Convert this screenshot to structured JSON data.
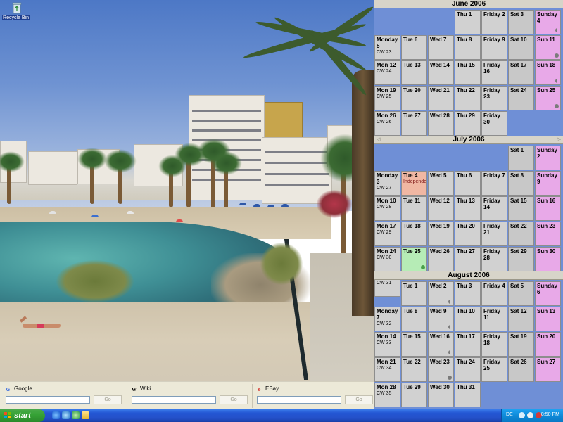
{
  "desktop": {
    "icon_label": "Recycle Bin"
  },
  "calendar": {
    "months": [
      {
        "title": "June 2006",
        "weeks": [
          {
            "label": "",
            "cw": "",
            "days": [
              {
                "text": "",
                "type": "empty"
              },
              {
                "text": "",
                "type": "empty"
              },
              {
                "text": "",
                "type": "empty"
              },
              {
                "text": "Thu 1",
                "type": "weekday"
              },
              {
                "text": "Friday 2",
                "type": "weekday"
              },
              {
                "text": "Sat 3",
                "type": "sat"
              },
              {
                "text": "Sunday 4",
                "type": "sun",
                "marker": "half"
              }
            ]
          },
          {
            "label": "Monday 5",
            "cw": "CW 23",
            "days": [
              {
                "text": "Tue 6",
                "type": "weekday"
              },
              {
                "text": "Wed 7",
                "type": "weekday"
              },
              {
                "text": "Thu 8",
                "type": "weekday"
              },
              {
                "text": "Friday 9",
                "type": "weekday"
              },
              {
                "text": "Sat 10",
                "type": "sat"
              },
              {
                "text": "Sun 11",
                "type": "sun",
                "marker": "dot"
              }
            ]
          },
          {
            "label": "Mon 12",
            "cw": "CW 24",
            "days": [
              {
                "text": "Tue 13",
                "type": "weekday"
              },
              {
                "text": "Wed 14",
                "type": "weekday"
              },
              {
                "text": "Thu 15",
                "type": "weekday"
              },
              {
                "text": "Friday 16",
                "type": "weekday"
              },
              {
                "text": "Sat 17",
                "type": "sat"
              },
              {
                "text": "Sun 18",
                "type": "sun",
                "marker": "half"
              }
            ]
          },
          {
            "label": "Mon 19",
            "cw": "CW 25",
            "days": [
              {
                "text": "Tue 20",
                "type": "weekday"
              },
              {
                "text": "Wed 21",
                "type": "weekday"
              },
              {
                "text": "Thu 22",
                "type": "weekday"
              },
              {
                "text": "Friday 23",
                "type": "weekday"
              },
              {
                "text": "Sat 24",
                "type": "sat"
              },
              {
                "text": "Sun 25",
                "type": "sun",
                "marker": "dot"
              }
            ]
          },
          {
            "label": "Mon 26",
            "cw": "CW 26",
            "days": [
              {
                "text": "Tue 27",
                "type": "weekday"
              },
              {
                "text": "Wed 28",
                "type": "weekday"
              },
              {
                "text": "Thu 29",
                "type": "weekday"
              },
              {
                "text": "Friday 30",
                "type": "weekday"
              },
              {
                "text": "",
                "type": "empty"
              },
              {
                "text": "",
                "type": "empty"
              }
            ]
          }
        ]
      },
      {
        "title": "July 2006",
        "nav_prev": "◁",
        "nav_next": "▷",
        "weeks": [
          {
            "label": "",
            "cw": "",
            "days": [
              {
                "text": "",
                "type": "empty"
              },
              {
                "text": "",
                "type": "empty"
              },
              {
                "text": "",
                "type": "empty"
              },
              {
                "text": "",
                "type": "empty"
              },
              {
                "text": "",
                "type": "empty"
              },
              {
                "text": "Sat 1",
                "type": "sat"
              },
              {
                "text": "Sunday 2",
                "type": "sun"
              }
            ]
          },
          {
            "label": "Monday 3",
            "cw": "CW 27",
            "days": [
              {
                "text": "Tue 4",
                "type": "holiday",
                "event": "Independence"
              },
              {
                "text": "Wed 5",
                "type": "weekday"
              },
              {
                "text": "Thu 6",
                "type": "weekday"
              },
              {
                "text": "Friday 7",
                "type": "weekday"
              },
              {
                "text": "Sat 8",
                "type": "sat"
              },
              {
                "text": "Sunday 9",
                "type": "sun"
              }
            ]
          },
          {
            "label": "Mon 10",
            "cw": "CW 28",
            "days": [
              {
                "text": "Tue 11",
                "type": "weekday"
              },
              {
                "text": "Wed 12",
                "type": "weekday"
              },
              {
                "text": "Thu 13",
                "type": "weekday"
              },
              {
                "text": "Friday 14",
                "type": "weekday"
              },
              {
                "text": "Sat 15",
                "type": "sat"
              },
              {
                "text": "Sun 16",
                "type": "sun"
              }
            ]
          },
          {
            "label": "Mon 17",
            "cw": "CW 29",
            "days": [
              {
                "text": "Tue 18",
                "type": "weekday"
              },
              {
                "text": "Wed 19",
                "type": "weekday"
              },
              {
                "text": "Thu 20",
                "type": "weekday"
              },
              {
                "text": "Friday 21",
                "type": "weekday"
              },
              {
                "text": "Sat 22",
                "type": "sat"
              },
              {
                "text": "Sun 23",
                "type": "sun"
              }
            ]
          },
          {
            "label": "Mon 24",
            "cw": "CW 30",
            "days": [
              {
                "text": "Tue 25",
                "type": "today",
                "marker": "green"
              },
              {
                "text": "Wed 26",
                "type": "weekday"
              },
              {
                "text": "Thu 27",
                "type": "weekday"
              },
              {
                "text": "Friday 28",
                "type": "weekday"
              },
              {
                "text": "Sat 29",
                "type": "sat"
              },
              {
                "text": "Sun 30",
                "type": "sun"
              }
            ]
          },
          {
            "label": "Mon 31",
            "cw": "CW 31",
            "days": [
              {
                "text": "",
                "type": "empty"
              },
              {
                "text": "",
                "type": "empty"
              },
              {
                "text": "",
                "type": "empty"
              },
              {
                "text": "",
                "type": "empty"
              },
              {
                "text": "",
                "type": "empty"
              },
              {
                "text": "",
                "type": "empty"
              }
            ]
          }
        ]
      },
      {
        "title": "August 2006",
        "weeks": [
          {
            "label": "",
            "cw": "",
            "days": [
              {
                "text": "Tue 1",
                "type": "weekday"
              },
              {
                "text": "Wed 2",
                "type": "weekday",
                "marker": "half"
              },
              {
                "text": "Thu 3",
                "type": "weekday"
              },
              {
                "text": "Friday 4",
                "type": "weekday"
              },
              {
                "text": "Sat 5",
                "type": "sat"
              },
              {
                "text": "Sunday 6",
                "type": "sun"
              }
            ]
          },
          {
            "label": "Monday 7",
            "cw": "CW 32",
            "days": [
              {
                "text": "Tue 8",
                "type": "weekday"
              },
              {
                "text": "Wed 9",
                "type": "weekday",
                "marker": "half"
              },
              {
                "text": "Thu 10",
                "type": "weekday"
              },
              {
                "text": "Friday 11",
                "type": "weekday"
              },
              {
                "text": "Sat 12",
                "type": "sat"
              },
              {
                "text": "Sun 13",
                "type": "sun"
              }
            ]
          },
          {
            "label": "Mon 14",
            "cw": "CW 33",
            "days": [
              {
                "text": "Tue 15",
                "type": "weekday"
              },
              {
                "text": "Wed 16",
                "type": "weekday",
                "marker": "half"
              },
              {
                "text": "Thu 17",
                "type": "weekday"
              },
              {
                "text": "Friday 18",
                "type": "weekday"
              },
              {
                "text": "Sat 19",
                "type": "sat"
              },
              {
                "text": "Sun 20",
                "type": "sun"
              }
            ]
          },
          {
            "label": "Mon 21",
            "cw": "CW 34",
            "days": [
              {
                "text": "Tue 22",
                "type": "weekday"
              },
              {
                "text": "Wed 23",
                "type": "weekday",
                "marker": "dot"
              },
              {
                "text": "Thu 24",
                "type": "weekday"
              },
              {
                "text": "Friday 25",
                "type": "weekday"
              },
              {
                "text": "Sat 26",
                "type": "sat"
              },
              {
                "text": "Sun 27",
                "type": "sun"
              }
            ]
          },
          {
            "label": "Mon 28",
            "cw": "CW 35",
            "days": [
              {
                "text": "Tue 29",
                "type": "weekday"
              },
              {
                "text": "Wed 30",
                "type": "weekday"
              },
              {
                "text": "Thu 31",
                "type": "weekday"
              },
              {
                "text": "",
                "type": "empty"
              },
              {
                "text": "",
                "type": "empty"
              },
              {
                "text": "",
                "type": "empty"
              }
            ]
          }
        ]
      }
    ]
  },
  "search": [
    {
      "name": "Google",
      "icon": "google-icon",
      "value": "",
      "button": "Go"
    },
    {
      "name": "Wiki",
      "icon": "wikipedia-icon",
      "value": "",
      "button": "Go"
    },
    {
      "name": "EBay",
      "icon": "ebay-icon",
      "value": "",
      "button": "Go"
    }
  ],
  "taskbar": {
    "start_label": "start",
    "quick_launch": [
      "ie-icon",
      "media-player-icon",
      "messenger-icon",
      "folder-icon"
    ],
    "tray": {
      "language": "DE",
      "clock": "8:50 PM"
    }
  },
  "colors": {
    "calendar_background": "#6f8fd6",
    "weekday": "#d1d1d1",
    "saturday": "#c8c8c8",
    "sunday": "#e8a9e8",
    "today": "#b6ecb6",
    "holiday": "#f0b7a3",
    "taskbar": "#2450c9",
    "start_button": "#36a336",
    "tray": "#0e8ad8"
  }
}
